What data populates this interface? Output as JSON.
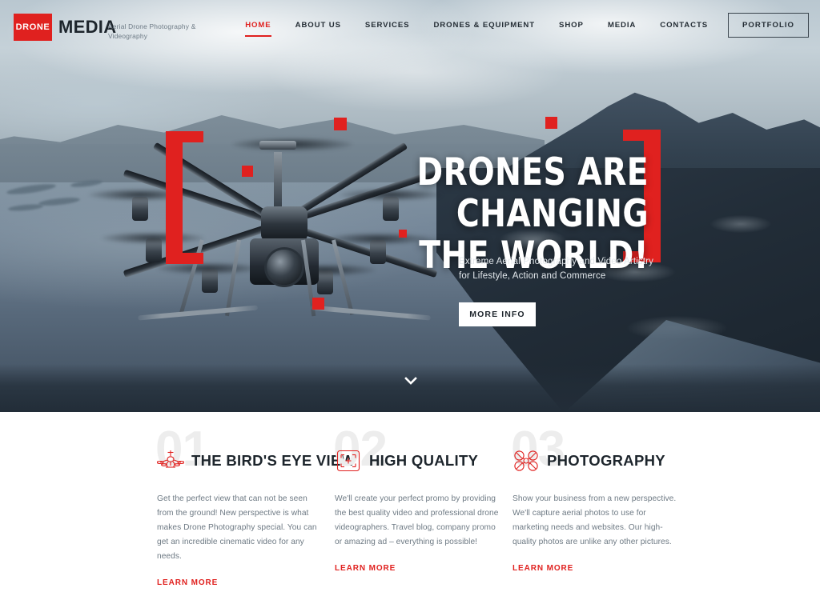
{
  "header": {
    "logo": {
      "mark_text": "DRONE",
      "word": "MEDIA",
      "icon": "drone-logo-icon"
    },
    "tagline": "Aerial Drone Photography & Videography",
    "nav": [
      {
        "label": "HOME",
        "active": true
      },
      {
        "label": "ABOUT US",
        "active": false
      },
      {
        "label": "SERVICES",
        "active": false
      },
      {
        "label": "DRONES & EQUIPMENT",
        "active": false
      },
      {
        "label": "SHOP",
        "active": false
      },
      {
        "label": "MEDIA",
        "active": false
      },
      {
        "label": "CONTACTS",
        "active": false
      }
    ],
    "portfolio_button": "PORTFOLIO"
  },
  "hero": {
    "headline_line1": "DRONES ARE CHANGING",
    "headline_line2": "THE WORLD!",
    "subcopy": "Extreme Aerial Photography and Video Artistry for Lifestyle, Action and Commerce",
    "cta_label": "MORE INFO",
    "scroll_icon": "chevron-down-icon"
  },
  "features": [
    {
      "number": "01",
      "icon": "drone-front-view-icon",
      "title": "THE BIRD'S EYE VIEW",
      "body": "Get the perfect view that can not be seen from the ground! New perspective is what makes Drone Photography special. You can get an incredible cinematic video for any needs.",
      "link": "LEARN MORE"
    },
    {
      "number": "02",
      "icon": "camera-focus-frame-icon",
      "title": "HIGH QUALITY",
      "body": "We'll create your perfect promo by providing the best quality video and professional drone videographers. Travel blog, company promo or amazing ad – everything is possible!",
      "link": "LEARN MORE"
    },
    {
      "number": "03",
      "icon": "quadcopter-top-view-icon",
      "title": "PHOTOGRAPHY",
      "body": "Show your business from a new perspective. We'll capture aerial photos to use for marketing needs and websites. Our high-quality photos are unlike any other pictures.",
      "link": "LEARN MORE"
    }
  ],
  "colors": {
    "accent_red": "#e0211f",
    "dark_text": "#1d252c",
    "body_text": "#6e7a84",
    "hero_bottom": "#222d38",
    "number_gray": "#ededed"
  }
}
